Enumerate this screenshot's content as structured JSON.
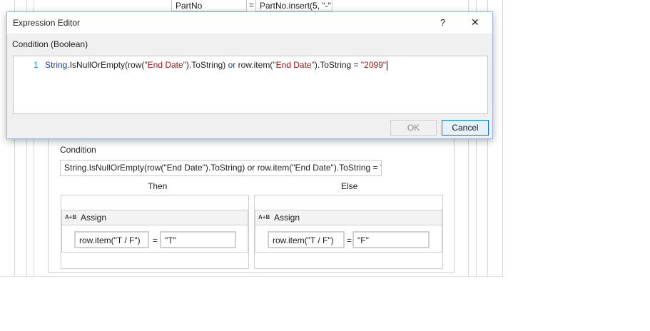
{
  "background": {
    "top_row": {
      "name": "PartNo",
      "operator": "=",
      "value": "PartNo.insert(5, \"-\""
    },
    "if_activity": {
      "condition_label": "Condition",
      "condition_value": "String.IsNullOrEmpty(row(\"End Date\").ToString) or row.item(\"End Date\").ToString = '",
      "then_label": "Then",
      "else_label": "Else",
      "then_assign": {
        "icon": "A+B",
        "title": "Assign",
        "to": "row.item(\"T / F\")",
        "operator": "=",
        "value": "\"T\""
      },
      "else_assign": {
        "icon": "A+B",
        "title": "Assign",
        "to": "row.item(\"T / F\")",
        "operator": "=",
        "value": "\"F\""
      }
    }
  },
  "dialog": {
    "title": "Expression Editor",
    "help_glyph": "?",
    "close_glyph": "✕",
    "section_label": "Condition (Boolean)",
    "line_number": "1",
    "code_tokens": [
      {
        "text": "String",
        "kind": "kw"
      },
      {
        "text": ".IsNullOrEmpty(row(",
        "kind": "plain"
      },
      {
        "text": "\"End Date\"",
        "kind": "str"
      },
      {
        "text": ").ToString) ",
        "kind": "plain"
      },
      {
        "text": "or",
        "kind": "kw"
      },
      {
        "text": " row.item(",
        "kind": "plain"
      },
      {
        "text": "\"End Date\"",
        "kind": "str"
      },
      {
        "text": ").ToString = ",
        "kind": "plain"
      },
      {
        "text": "\"2099\"",
        "kind": "str"
      }
    ],
    "ok_label": "OK",
    "cancel_label": "Cancel"
  },
  "colors": {
    "keyword": "#1f3da0",
    "string": "#a31515",
    "focus_border": "#0078d7"
  }
}
